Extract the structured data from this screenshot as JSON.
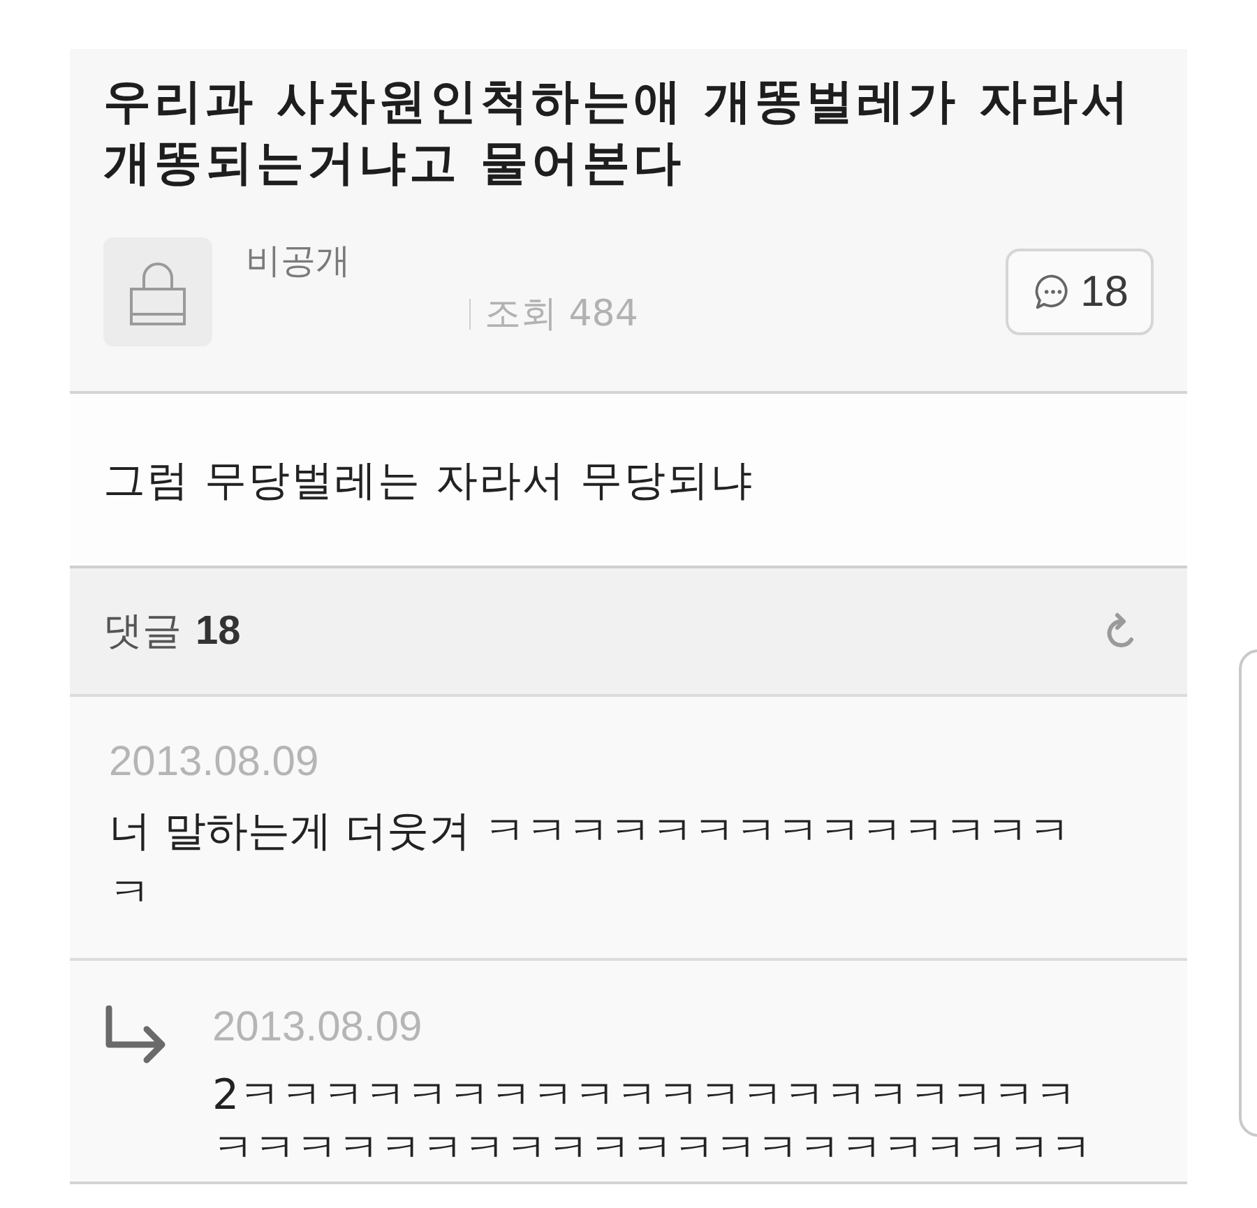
{
  "post": {
    "title": "우리과 사차원인척하는애 개똥벌레가 자라서 개똥되는거냐고 물어본다",
    "author": "비공개",
    "views": "조회 484",
    "comment_count": "18",
    "body": "그럼 무당벌레는 자라서 무당되냐"
  },
  "comments_header": {
    "label": "댓글",
    "count": "18"
  },
  "comments": [
    {
      "kind": "comment",
      "date": "2013.08.09",
      "text": "너 말하는게 더웃겨 ㅋㅋㅋㅋㅋㅋㅋㅋㅋㅋㅋㅋㅋㅋㅋ"
    },
    {
      "kind": "reply",
      "date": "2013.08.09",
      "text": "2ㅋㅋㅋㅋㅋㅋㅋㅋㅋㅋㅋㅋㅋㅋㅋㅋㅋㅋㅋㅋㅋㅋㅋㅋㅋㅋㅋㅋㅋㅋㅋㅋㅋㅋㅋㅋㅋㅋㅋㅋㅋ"
    }
  ]
}
